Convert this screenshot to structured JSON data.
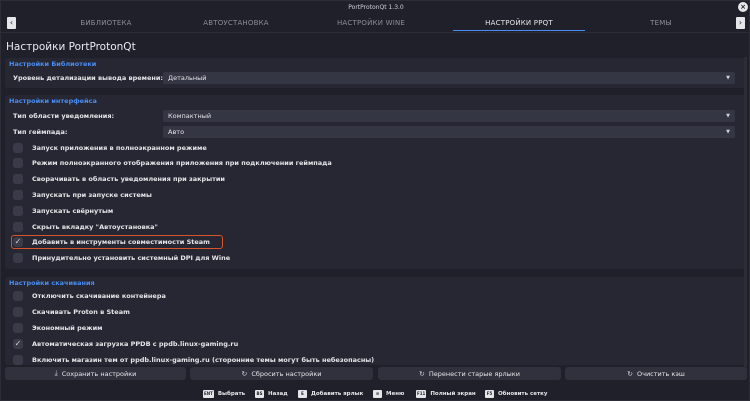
{
  "window": {
    "title": "PortProtonQt 1.3.0"
  },
  "tabs": [
    {
      "label": "БИБЛИОТЕКА"
    },
    {
      "label": "АВТОУСТАНОВКА"
    },
    {
      "label": "НАСТРОЙКИ WINE"
    },
    {
      "label": "НАСТРОЙКИ PPQT"
    },
    {
      "label": "ТЕМЫ"
    }
  ],
  "page": {
    "title": "Настройки PortProtonQt"
  },
  "library_settings": {
    "title": "Настройки Библиотеки",
    "time_detail": {
      "label": "Уровень детализации вывода времени:",
      "value": "Детальный"
    }
  },
  "interface_settings": {
    "title": "Настройки интерфейса",
    "notify_area": {
      "label": "Тип области уведомления:",
      "value": "Компактный"
    },
    "gamepad_type": {
      "label": "Тип геймпада:",
      "value": "Авто"
    },
    "checkboxes": [
      {
        "label": "Запуск приложения в полноэкранном режиме",
        "checked": false
      },
      {
        "label": "Режим полноэкранного отображения приложения при подключении геймпада",
        "checked": false
      },
      {
        "label": "Сворачивать в область уведомления при закрытии",
        "checked": false
      },
      {
        "label": "Запускать при запуске системы",
        "checked": false
      },
      {
        "label": "Запускать свёрнутым",
        "checked": false
      },
      {
        "label": "Скрыть вкладку \"Автоустановка\"",
        "checked": false
      },
      {
        "label": "Добавить в инструменты совместимости Steam",
        "checked": true
      },
      {
        "label": "Принудительно установить системный DPI для Wine",
        "checked": false
      }
    ]
  },
  "download_settings": {
    "title": "Настройки скачивания",
    "checkboxes": [
      {
        "label": "Отключить скачивание контейнера",
        "checked": false
      },
      {
        "label": "Скачивать Proton в Steam",
        "checked": false
      },
      {
        "label": "Экономный режим",
        "checked": false
      },
      {
        "label": "Автоматическая загрузка PPDB с ppdb.linux-gaming.ru",
        "checked": true
      },
      {
        "label": "Включить магазин тем от ppdb.linux-gaming.ru (сторонние темы могут быть небезопасны)",
        "checked": false
      }
    ]
  },
  "buttons": [
    {
      "label": "Сохранить настройки",
      "icon": "download-icon",
      "glyph": "⤓"
    },
    {
      "label": "Сбросить настройки",
      "icon": "refresh-icon",
      "glyph": "↻"
    },
    {
      "label": "Перенести старые ярлыки",
      "icon": "refresh-icon",
      "glyph": "↻"
    },
    {
      "label": "Очистить кэш",
      "icon": "refresh-icon",
      "glyph": "↻"
    }
  ],
  "hints": [
    {
      "key": "ENT",
      "label": "Выбрать"
    },
    {
      "key": "BS",
      "label": "Назад"
    },
    {
      "key": "E",
      "label": "Добавить ярлык"
    },
    {
      "key": "",
      "label": "Меню"
    },
    {
      "key": "F11",
      "label": "Полный экран"
    },
    {
      "key": "F5",
      "label": "Обновить сетку"
    }
  ]
}
